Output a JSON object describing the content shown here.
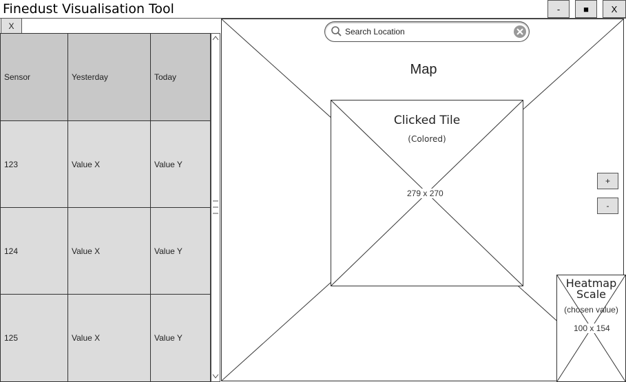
{
  "window": {
    "title": "Finedust Visualisation Tool",
    "minimize_label": "-",
    "maximize_label": "■",
    "close_label": "X"
  },
  "sidebar": {
    "close_label": "X",
    "table": {
      "headers": [
        "Sensor",
        "Yesterday",
        "Today"
      ],
      "rows": [
        [
          "123",
          "Value X",
          "Value Y"
        ],
        [
          "124",
          "Value X",
          "Value Y"
        ],
        [
          "125",
          "Value X",
          "Value Y"
        ]
      ]
    }
  },
  "map": {
    "label": "Map",
    "search": {
      "placeholder": "Search Location"
    },
    "tile": {
      "title": "Clicked Tile",
      "subtitle": "(Colored)",
      "size_label": "279 x 270"
    },
    "zoom_in_label": "+",
    "zoom_out_label": "-",
    "scale": {
      "title_line1": "Heatmap",
      "title_line2": "Scale",
      "subtitle": "(chosen value)",
      "size_label": "100 x 154"
    }
  },
  "icons": {
    "search": "search-icon",
    "clear": "clear-icon",
    "scroll_up": "chevron-up-icon",
    "scroll_down": "chevron-down-icon"
  }
}
